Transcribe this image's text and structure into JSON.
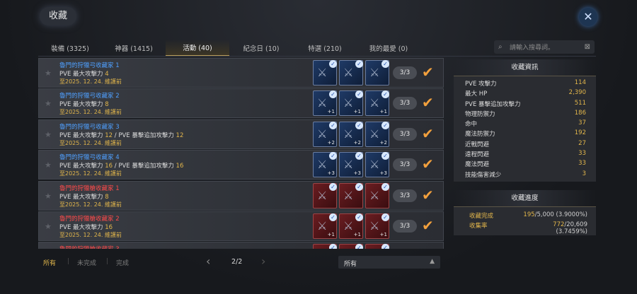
{
  "window": {
    "title": "收藏",
    "close_icon": "close-icon"
  },
  "tabs": [
    {
      "label": "裝備 (3325)"
    },
    {
      "label": "神器 (1415)"
    },
    {
      "label": "活動 (40)",
      "active": true
    },
    {
      "label": "紀念日 (10)"
    },
    {
      "label": "特選 (210)"
    },
    {
      "label": "我的最愛 (0)"
    }
  ],
  "search": {
    "placeholder": "請輸入搜尋詞。"
  },
  "rows": [
    {
      "name": "魯門的狩獵弓收藏家 1",
      "name_color": "#4fa0ff",
      "desc": "PVE 最大攻擊力 ",
      "desc_val": "4",
      "desc2": "",
      "desc2_val": "",
      "date": "至2025. 12. 24. 維護前",
      "color": "blue",
      "plus": [
        "",
        "",
        ""
      ],
      "count": "3/3"
    },
    {
      "name": "魯門的狩獵弓收藏家 2",
      "name_color": "#4fa0ff",
      "desc": "PVE 最大攻擊力 ",
      "desc_val": "8",
      "desc2": "",
      "desc2_val": "",
      "date": "至2025. 12. 24. 維護前",
      "color": "blue",
      "plus": [
        "+1",
        "+1",
        "+1"
      ],
      "count": "3/3"
    },
    {
      "name": "魯門的狩獵弓收藏家 3",
      "name_color": "#4fa0ff",
      "desc": "PVE 最大攻擊力 ",
      "desc_val": "12",
      "desc2": " / PVE 暴擊追加攻擊力 ",
      "desc2_val": "12",
      "date": "至2025. 12. 24. 維護前",
      "color": "blue",
      "plus": [
        "+2",
        "+2",
        "+2"
      ],
      "count": "3/3"
    },
    {
      "name": "魯門的狩獵弓收藏家 4",
      "name_color": "#4fa0ff",
      "desc": "PVE 最大攻擊力 ",
      "desc_val": "16",
      "desc2": " / PVE 暴擊追加攻擊力 ",
      "desc2_val": "16",
      "date": "至2025. 12. 24. 維護前",
      "color": "blue",
      "plus": [
        "+3",
        "+3",
        "+3"
      ],
      "count": "3/3"
    },
    {
      "name": "魯門的狩獵槍收藏家 1",
      "name_color": "#ff4a4a",
      "desc": "PVE 最大攻擊力 ",
      "desc_val": "8",
      "desc2": "",
      "desc2_val": "",
      "date": "至2025. 12. 24. 維護前",
      "color": "red",
      "plus": [
        "",
        "",
        ""
      ],
      "count": "3/3"
    },
    {
      "name": "魯門的狩獵槍收藏家 2",
      "name_color": "#ff4a4a",
      "desc": "PVE 最大攻擊力 ",
      "desc_val": "16",
      "desc2": "",
      "desc2_val": "",
      "date": "至2025. 12. 24. 維護前",
      "color": "red",
      "plus": [
        "+1",
        "+1",
        "+1"
      ],
      "count": "3/3"
    },
    {
      "name": "魯門的狩獵槍收藏家 3",
      "name_color": "#ff4a4a",
      "desc": "",
      "desc_val": "",
      "desc2": "",
      "desc2_val": "",
      "date": "",
      "color": "red",
      "plus": [
        "",
        "",
        ""
      ],
      "count": "3/3"
    }
  ],
  "panel": {
    "title": "收藏資訊",
    "stats": [
      {
        "name": "PVE 攻擊力",
        "value": "114"
      },
      {
        "name": "最大 HP",
        "value": "2,390"
      },
      {
        "name": "PVE 暴擊追加攻擊力",
        "value": "511"
      },
      {
        "name": "物理防禦力",
        "value": "186"
      },
      {
        "name": "命中",
        "value": "37"
      },
      {
        "name": "魔法防禦力",
        "value": "192"
      },
      {
        "name": "近戰閃避",
        "value": "27"
      },
      {
        "name": "遠程閃避",
        "value": "33"
      },
      {
        "name": "魔法閃避",
        "value": "33"
      },
      {
        "name": "技能傷害減少",
        "value": "3"
      }
    ],
    "progress_title": "收藏進度",
    "progress": [
      {
        "name": "收藏完成",
        "value": "195",
        "rest": "/5,000 (3.9000%)"
      },
      {
        "name": "收集率",
        "value": "772",
        "rest": "/20,609 (3.7459%)"
      }
    ]
  },
  "footer": {
    "filters": [
      "所有",
      "未完成",
      "完成"
    ],
    "page": "2/2",
    "dropdown": "所有"
  }
}
